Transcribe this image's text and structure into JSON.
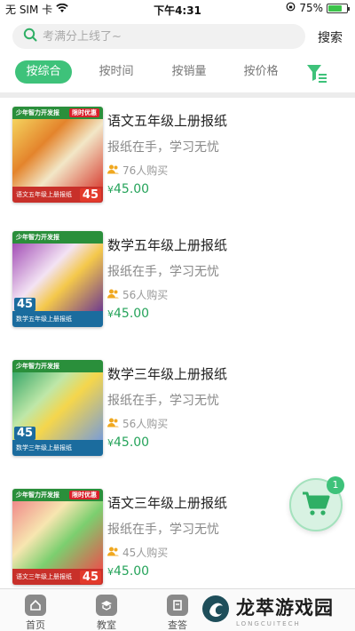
{
  "status_bar": {
    "carrier": "无 SIM 卡",
    "time": "下午4:31",
    "battery": "75%",
    "battery_level": 0.75
  },
  "search": {
    "placeholder": "考满分上线了~",
    "button_label": "搜索"
  },
  "sort_tabs": [
    {
      "label": "按综合",
      "active": true
    },
    {
      "label": "按时间",
      "active": false
    },
    {
      "label": "按销量",
      "active": false
    },
    {
      "label": "按价格",
      "active": false
    }
  ],
  "products": [
    {
      "title": "语文五年级上册报纸",
      "subtitle": "报纸在手，学习无忧",
      "buyers": "76人购买",
      "currency": "¥",
      "price": "45.00",
      "thumb": {
        "banner": "少年智力开发报",
        "tag": "限时优惠",
        "footer": "语文五年级上册报纸",
        "price": "45",
        "accent": "#e33a2b"
      }
    },
    {
      "title": "数学五年级上册报纸",
      "subtitle": "报纸在手，学习无忧",
      "buyers": "56人购买",
      "currency": "¥",
      "price": "45.00",
      "thumb": {
        "banner": "少年智力开发报",
        "tag": "",
        "footer": "数学五年级上册报纸",
        "price": "45",
        "accent": "#1b6c9e"
      }
    },
    {
      "title": "数学三年级上册报纸",
      "subtitle": "报纸在手，学习无忧",
      "buyers": "56人购买",
      "currency": "¥",
      "price": "45.00",
      "thumb": {
        "banner": "少年智力开发报",
        "tag": "",
        "footer": "数学三年级上册报纸",
        "price": "45",
        "accent": "#1b6c9e"
      }
    },
    {
      "title": "语文三年级上册报纸",
      "subtitle": "报纸在手，学习无忧",
      "buyers": "45人购买",
      "currency": "¥",
      "price": "45.00",
      "thumb": {
        "banner": "少年智力开发报",
        "tag": "限时优惠",
        "footer": "语文三年级上册报纸",
        "price": "45",
        "accent": "#e33a2b"
      }
    }
  ],
  "cart": {
    "badge": "1"
  },
  "tab_bar": [
    {
      "label": "首页",
      "icon": "home-icon"
    },
    {
      "label": "教室",
      "icon": "classroom-icon"
    },
    {
      "label": "查答",
      "icon": "answers-icon"
    }
  ],
  "watermark": {
    "text": "龙萃游戏园",
    "sub": "LONGCUITECH"
  },
  "colors": {
    "accent": "#3ec27a",
    "price": "#25a35a"
  }
}
